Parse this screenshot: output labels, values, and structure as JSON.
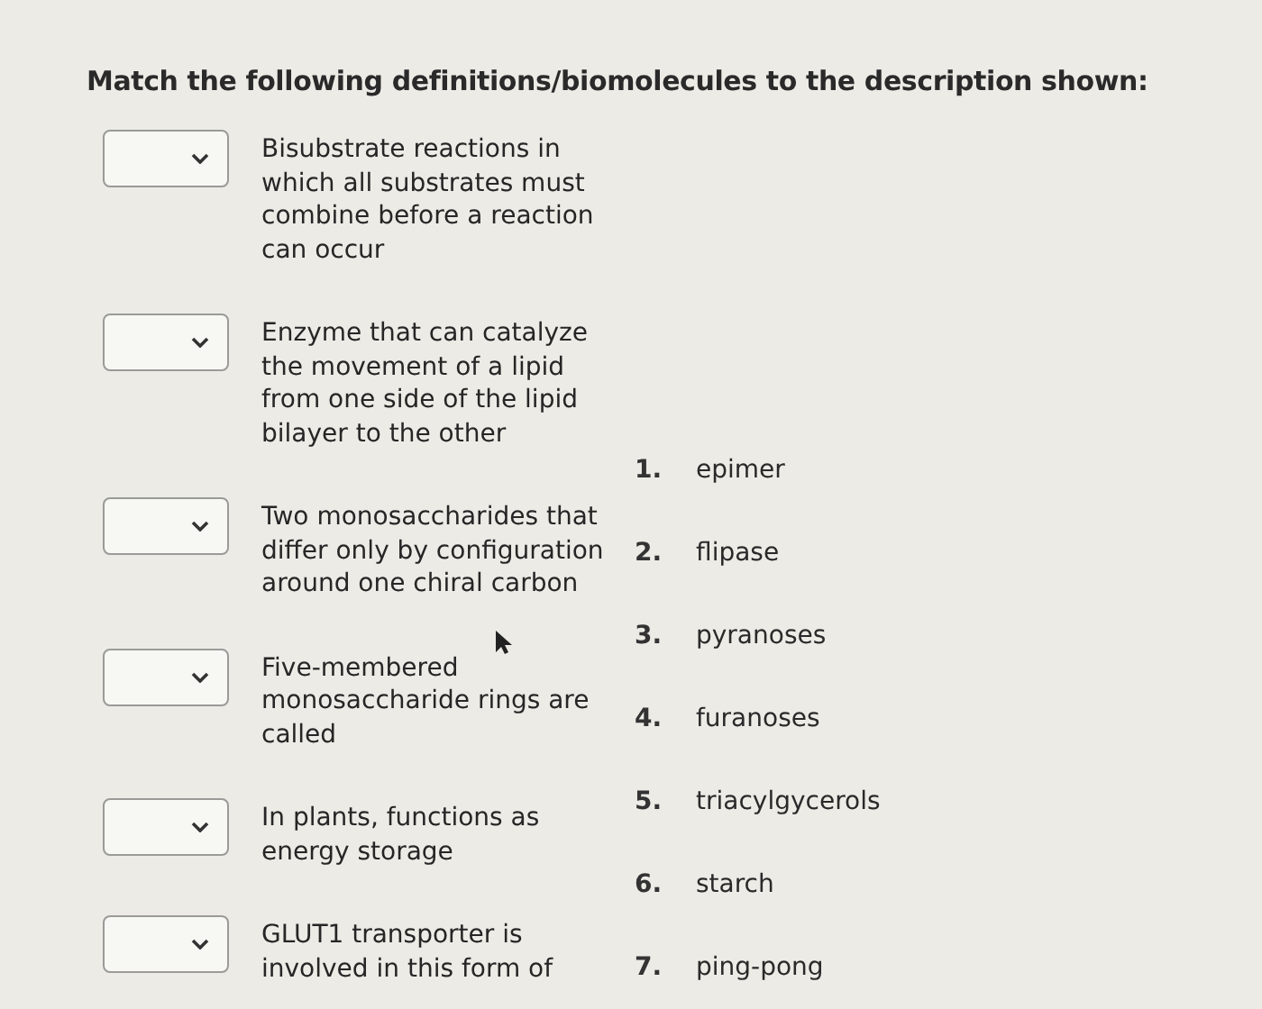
{
  "question": {
    "prompt": "Match the following definitions/biomolecules to the description shown:",
    "items": [
      {
        "description": "Bisubstrate reactions in which all substrates must combine before a reaction can occur"
      },
      {
        "description": "Enzyme that can catalyze the movement of a lipid from one side of the lipid bilayer to the other"
      },
      {
        "description": "Two monosaccharides that differ only by configuration around one chiral carbon"
      },
      {
        "description": "Five-membered monosaccharide rings are called"
      },
      {
        "description": "In plants, functions as energy storage"
      },
      {
        "description": "GLUT1 transporter is involved in this form of"
      }
    ],
    "options": [
      {
        "number": "1.",
        "label": "epimer"
      },
      {
        "number": "2.",
        "label": "flipase"
      },
      {
        "number": "3.",
        "label": "pyranoses"
      },
      {
        "number": "4.",
        "label": "furanoses"
      },
      {
        "number": "5.",
        "label": "triacylgycerols"
      },
      {
        "number": "6.",
        "label": "starch"
      },
      {
        "number": "7.",
        "label": "ping-pong"
      }
    ]
  }
}
